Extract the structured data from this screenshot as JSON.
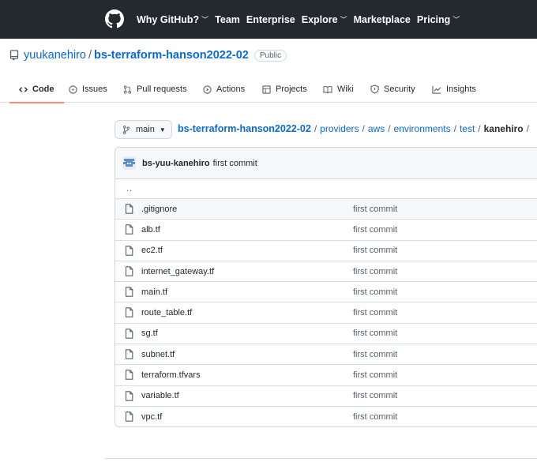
{
  "header": {
    "logo_icon": "github-mark-icon",
    "nav": [
      {
        "label": "Why GitHub?",
        "dropdown": true
      },
      {
        "label": "Team",
        "dropdown": false
      },
      {
        "label": "Enterprise",
        "dropdown": false
      },
      {
        "label": "Explore",
        "dropdown": true
      },
      {
        "label": "Marketplace",
        "dropdown": false
      },
      {
        "label": "Pricing",
        "dropdown": true
      }
    ]
  },
  "repo": {
    "owner": "yuukanehiro",
    "separator": "/",
    "name": "bs-terraform-hanson2022-02",
    "visibility": "Public"
  },
  "tabs": [
    {
      "label": "Code",
      "icon": "code-icon",
      "active": true
    },
    {
      "label": "Issues",
      "icon": "issue-icon",
      "active": false
    },
    {
      "label": "Pull requests",
      "icon": "pull-request-icon",
      "active": false
    },
    {
      "label": "Actions",
      "icon": "play-icon",
      "active": false
    },
    {
      "label": "Projects",
      "icon": "table-icon",
      "active": false
    },
    {
      "label": "Wiki",
      "icon": "book-icon",
      "active": false
    },
    {
      "label": "Security",
      "icon": "shield-icon",
      "active": false
    },
    {
      "label": "Insights",
      "icon": "graph-icon",
      "active": false
    }
  ],
  "branch": {
    "label": "main",
    "icon": "git-branch-icon"
  },
  "breadcrumb": {
    "root": "bs-terraform-hanson2022-02",
    "parts": [
      "providers",
      "aws",
      "environments",
      "test"
    ],
    "current": "kanehiro",
    "separator": "/"
  },
  "latest_commit": {
    "author": "bs-yuu-kanehiro",
    "message": "first commit"
  },
  "parent_dir": "..",
  "files": [
    {
      "name": ".gitignore",
      "commit": "first commit"
    },
    {
      "name": "alb.tf",
      "commit": "first commit"
    },
    {
      "name": "ec2.tf",
      "commit": "first commit"
    },
    {
      "name": "internet_gateway.tf",
      "commit": "first commit"
    },
    {
      "name": "main.tf",
      "commit": "first commit"
    },
    {
      "name": "route_table.tf",
      "commit": "first commit"
    },
    {
      "name": "sg.tf",
      "commit": "first commit"
    },
    {
      "name": "subnet.tf",
      "commit": "first commit"
    },
    {
      "name": "terraform.tfvars",
      "commit": "first commit"
    },
    {
      "name": "variable.tf",
      "commit": "first commit"
    },
    {
      "name": "vpc.tf",
      "commit": "first commit"
    }
  ],
  "colors": {
    "header_bg": "#24292f",
    "link": "#0969da",
    "tab_underline": "#fd8c73",
    "border": "#d0d7de"
  }
}
